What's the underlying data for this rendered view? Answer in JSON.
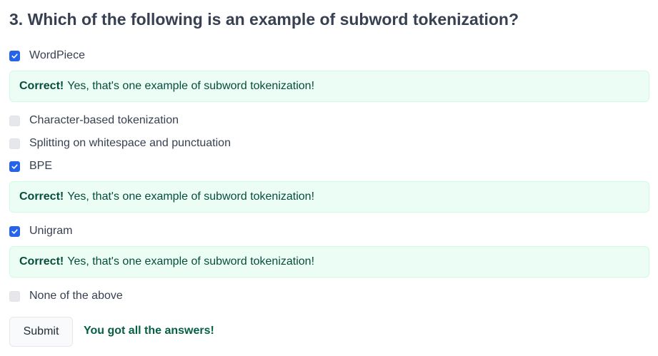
{
  "question": {
    "title": "3. Which of the following is an example of subword tokenization?"
  },
  "options": [
    {
      "label": "WordPiece",
      "checked": true
    },
    {
      "label": "Character-based tokenization",
      "checked": false
    },
    {
      "label": "Splitting on whitespace and punctuation",
      "checked": false
    },
    {
      "label": "BPE",
      "checked": true
    },
    {
      "label": "Unigram",
      "checked": true
    },
    {
      "label": "None of the above",
      "checked": false
    }
  ],
  "feedback": [
    {
      "strong": "Correct!",
      "text": "Yes, that's one example of subword tokenization!"
    },
    {
      "strong": "Correct!",
      "text": "Yes, that's one example of subword tokenization!"
    },
    {
      "strong": "Correct!",
      "text": "Yes, that's one example of subword tokenization!"
    }
  ],
  "actions": {
    "submit_label": "Submit",
    "result_message": "You got all the answers!"
  },
  "colors": {
    "checkbox_checked": "#2563eb",
    "checkbox_unchecked": "#e5e7eb",
    "feedback_background": "#ecfdf5",
    "feedback_text": "#064e3b",
    "result_text": "#065f46"
  }
}
